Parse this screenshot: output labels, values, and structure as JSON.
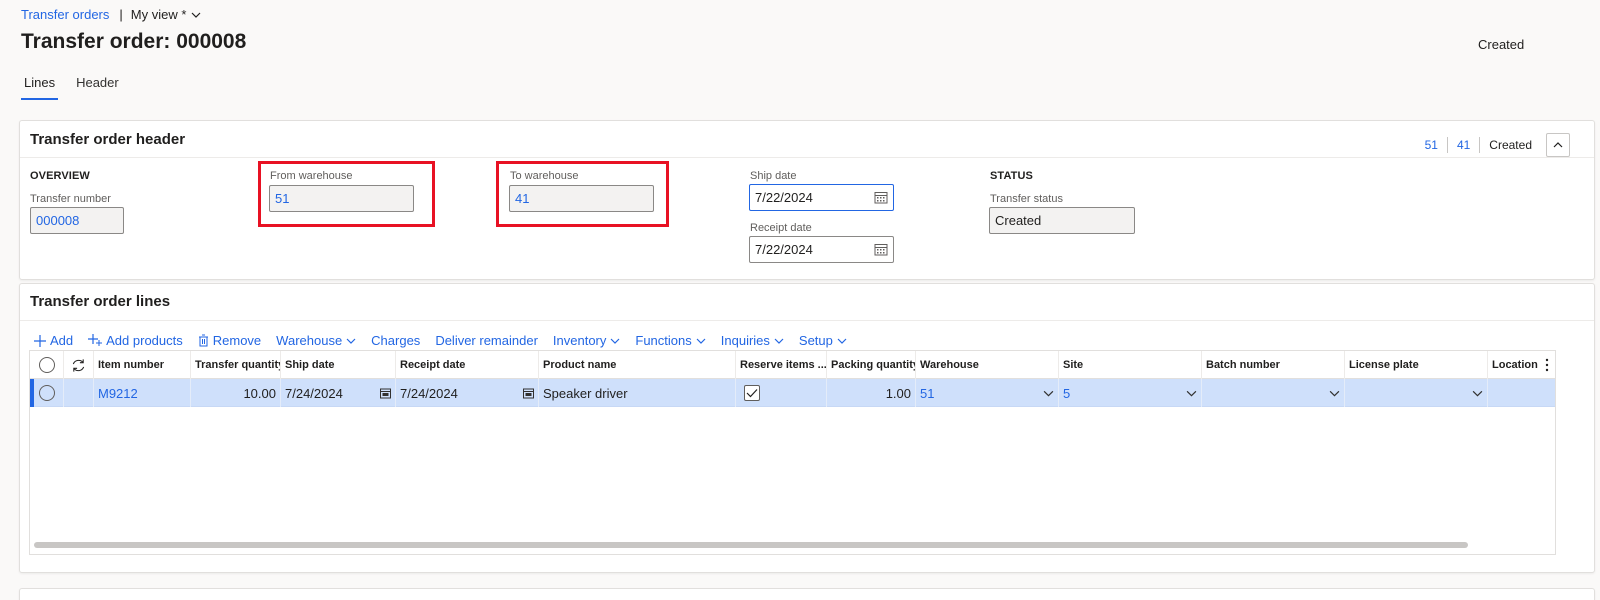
{
  "breadcrumb": {
    "parent": "Transfer orders",
    "separator": "|",
    "view": "My view *"
  },
  "page": {
    "title": "Transfer order: 000008",
    "status": "Created"
  },
  "tabs": [
    {
      "label": "Lines",
      "active": true
    },
    {
      "label": "Header",
      "active": false
    }
  ],
  "header_card": {
    "title": "Transfer order header",
    "summary": {
      "from": "51",
      "to": "41",
      "status": "Created"
    },
    "overview": {
      "section": "OVERVIEW",
      "transfer_number_label": "Transfer number",
      "transfer_number": "000008"
    },
    "from_warehouse": {
      "label": "From warehouse",
      "value": "51"
    },
    "to_warehouse": {
      "label": "To warehouse",
      "value": "41"
    },
    "ship_date": {
      "label": "Ship date",
      "value": "7/22/2024"
    },
    "receipt_date": {
      "label": "Receipt date",
      "value": "7/22/2024"
    },
    "status": {
      "section": "STATUS",
      "label": "Transfer status",
      "value": "Created"
    }
  },
  "lines_card": {
    "title": "Transfer order lines",
    "toolbar": {
      "add": "Add",
      "add_products": "Add products",
      "remove": "Remove",
      "warehouse": "Warehouse",
      "charges": "Charges",
      "deliver_remainder": "Deliver remainder",
      "inventory": "Inventory",
      "functions": "Functions",
      "inquiries": "Inquiries",
      "setup": "Setup"
    },
    "columns": {
      "item_number": "Item number",
      "transfer_quantity": "Transfer quantity",
      "ship_date": "Ship date",
      "receipt_date": "Receipt date",
      "product_name": "Product name",
      "reserve_items": "Reserve items ...",
      "packing_quantity": "Packing quantity",
      "warehouse": "Warehouse",
      "site": "Site",
      "batch_number": "Batch number",
      "license_plate": "License plate",
      "location": "Location"
    },
    "rows": [
      {
        "item_number": "M9212",
        "transfer_quantity": "10.00",
        "ship_date": "7/24/2024",
        "receipt_date": "7/24/2024",
        "product_name": "Speaker driver",
        "reserve_items": true,
        "packing_quantity": "1.00",
        "warehouse": "51",
        "site": "5",
        "batch_number": "",
        "license_plate": ""
      }
    ]
  },
  "colors": {
    "accent": "#2266e3",
    "highlight_box": "#e81123",
    "selected_row": "#cfe0fb"
  }
}
